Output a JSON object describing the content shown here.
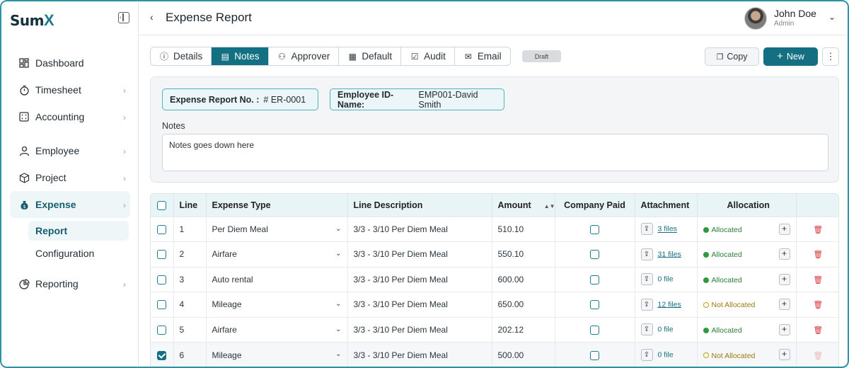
{
  "brand": {
    "name": "Sum",
    "accent": "X"
  },
  "sidebar": {
    "items": [
      {
        "label": "Dashboard",
        "icon": "dashboard-icon",
        "chevron": false
      },
      {
        "label": "Timesheet",
        "icon": "timer-icon",
        "chevron": true
      },
      {
        "label": "Accounting",
        "icon": "calculator-icon",
        "chevron": true
      },
      {
        "label": "Employee",
        "icon": "user-icon",
        "chevron": true
      },
      {
        "label": "Project",
        "icon": "box-icon",
        "chevron": true
      },
      {
        "label": "Expense",
        "icon": "money-bag-icon",
        "chevron": true,
        "active": true
      },
      {
        "label": "Reporting",
        "icon": "pie-chart-icon",
        "chevron": true
      }
    ],
    "expense_sub": [
      {
        "label": "Report",
        "active": true
      },
      {
        "label": "Configuration"
      }
    ]
  },
  "header": {
    "title": "Expense Report",
    "user": {
      "name": "John Doe",
      "role": "Admin"
    }
  },
  "tabs": [
    {
      "label": "Details",
      "icon": "info-icon"
    },
    {
      "label": "Notes",
      "icon": "document-icon",
      "active": true
    },
    {
      "label": "Approver",
      "icon": "person-icon"
    },
    {
      "label": "Default",
      "icon": "table-icon"
    },
    {
      "label": "Audit",
      "icon": "clipboard-icon"
    },
    {
      "label": "Email",
      "icon": "mail-icon"
    }
  ],
  "status_badge": "Draft",
  "actions": {
    "copy": "Copy",
    "new": "New"
  },
  "info": {
    "report_no_label": "Expense Report No. :",
    "report_no_value": "# ER-0001",
    "employee_label": "Employee ID-Name:",
    "employee_value": "EMP001-David Smith",
    "notes_label": "Notes",
    "notes_value": "Notes goes down here"
  },
  "table": {
    "headers": {
      "line": "Line",
      "expense_type": "Expense Type",
      "line_description": "Line Description",
      "amount": "Amount",
      "company_paid": "Company Paid",
      "attachment": "Attachment",
      "allocation": "Allocation"
    },
    "rows": [
      {
        "line": "1",
        "type": "Per Diem Meal",
        "dropdown": true,
        "desc": "3/3 - 3/10 Per Diem Meal",
        "amount": "510.10",
        "files": "3 files",
        "alloc": "Allocated",
        "checked": false
      },
      {
        "line": "2",
        "type": "Airfare",
        "dropdown": true,
        "desc": "3/3 - 3/10 Per Diem Meal",
        "amount": "550.10",
        "files": "31 files",
        "alloc": "Allocated",
        "checked": false
      },
      {
        "line": "3",
        "type": "Auto rental",
        "dropdown": false,
        "desc": "3/3 - 3/10 Per Diem Meal",
        "amount": "600.00",
        "files": "0 file",
        "alloc": "Allocated",
        "checked": false
      },
      {
        "line": "4",
        "type": "Mileage",
        "dropdown": true,
        "desc": "3/3 - 3/10 Per Diem Meal",
        "amount": "650.00",
        "files": "12 files",
        "alloc": "Not Allocated",
        "checked": false
      },
      {
        "line": "5",
        "type": "Airfare",
        "dropdown": true,
        "desc": "3/3 - 3/10 Per Diem Meal",
        "amount": "202.12",
        "files": "0 file",
        "alloc": "Allocated",
        "checked": false
      },
      {
        "line": "6",
        "type": "Mileage",
        "dropdown": true,
        "desc": "3/3 - 3/10 Per Diem Meal",
        "amount": "500.00",
        "files": "0 file",
        "alloc": "Not Allocated",
        "checked": true
      }
    ]
  },
  "colors": {
    "primary": "#136f82",
    "allocated": "#2e9a3f",
    "not_allocated": "#c89b12",
    "delete": "#d63a3a"
  }
}
